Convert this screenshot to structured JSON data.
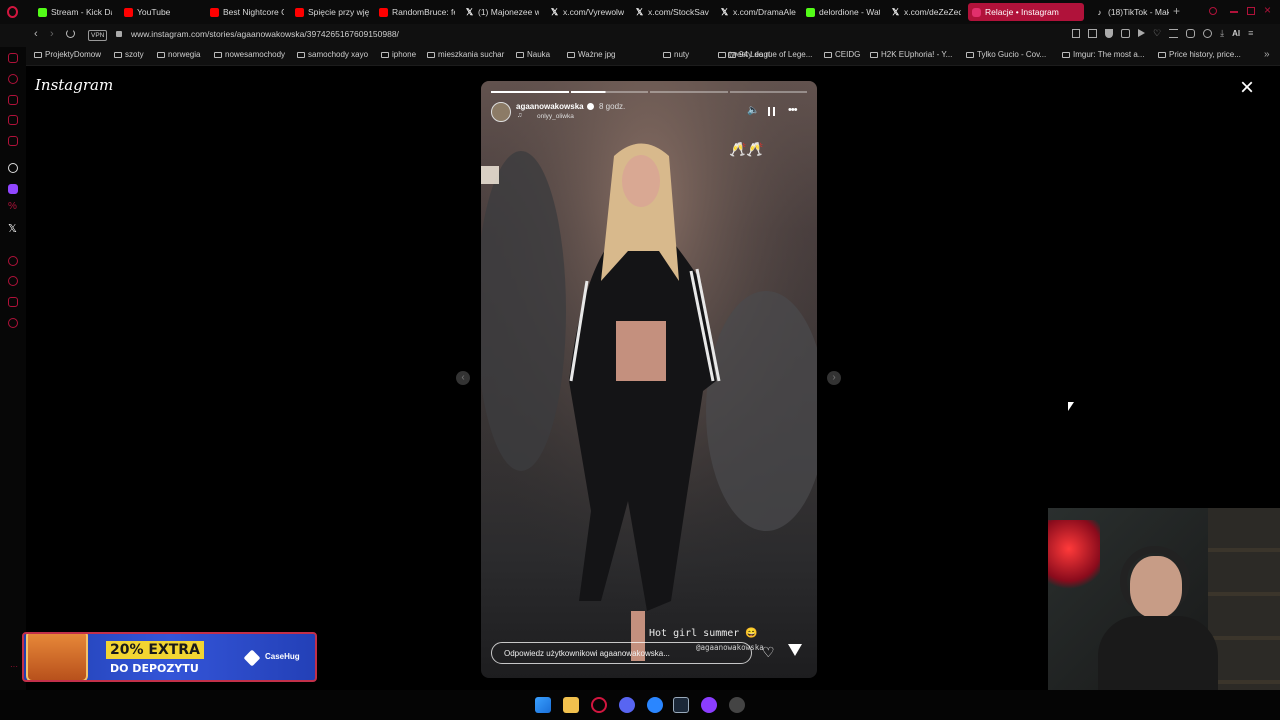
{
  "browser": {
    "tabs": [
      {
        "label": "Stream - Kick Da",
        "icon": "kick-icon"
      },
      {
        "label": "YouTube",
        "icon": "youtube-icon"
      },
      {
        "label": "Best Nightcore G",
        "icon": "youtube-icon"
      },
      {
        "label": "Spięcie przy wję",
        "icon": "youtube-icon"
      },
      {
        "label": "RandomBruce: fe",
        "icon": "youtube-icon"
      },
      {
        "label": "(1) Majonezee w",
        "icon": "x-icon"
      },
      {
        "label": "x.com/Vyrewolw",
        "icon": "x-icon"
      },
      {
        "label": "x.com/StockSav",
        "icon": "x-icon"
      },
      {
        "label": "x.com/DramaAle",
        "icon": "x-icon"
      },
      {
        "label": "delordione - Wat",
        "icon": "kick-icon"
      },
      {
        "label": "x.com/deZeZed",
        "icon": "x-icon"
      },
      {
        "label": "Relacje • Instagram",
        "icon": "instagram-icon",
        "active": true
      },
      {
        "label": "(18)TikTok - Mak",
        "icon": "tiktok-icon"
      }
    ],
    "vpn_label": "VPN",
    "url": "www.instagram.com/stories/agaanowakowska/3974265167609150988/",
    "ai_label": "AI",
    "bookmarks": [
      "ProjektyDomow",
      "szoty",
      "norwegia",
      "nowesamochody",
      "samochody xayo",
      "iphone",
      "mieszkania suchar",
      "Nauka",
      "Ważne jpg",
      "nuty",
      "tweety do rt",
      "94 League of Lege...",
      "CEIDG",
      "H2K EUphoria! - Y...",
      "Tylko Gucio - Cov...",
      "Imgur: The most a...",
      "Price history, price..."
    ]
  },
  "instagram": {
    "logo": "Instagram",
    "story": {
      "username": "agaanowakowska",
      "time": "8 godz.",
      "music": "onlyy_oliwka",
      "overlay_text": "Hot girl summer 😄",
      "mention": "@agaanowakowska",
      "reply_placeholder": "Odpowiedz użytkownikowi agaanowakowska...",
      "sticker": "🥂🥂"
    }
  },
  "promo": {
    "headline": "20% EXTRA",
    "subline": "DO DEPOZYTU",
    "brand": "CaseHug"
  }
}
